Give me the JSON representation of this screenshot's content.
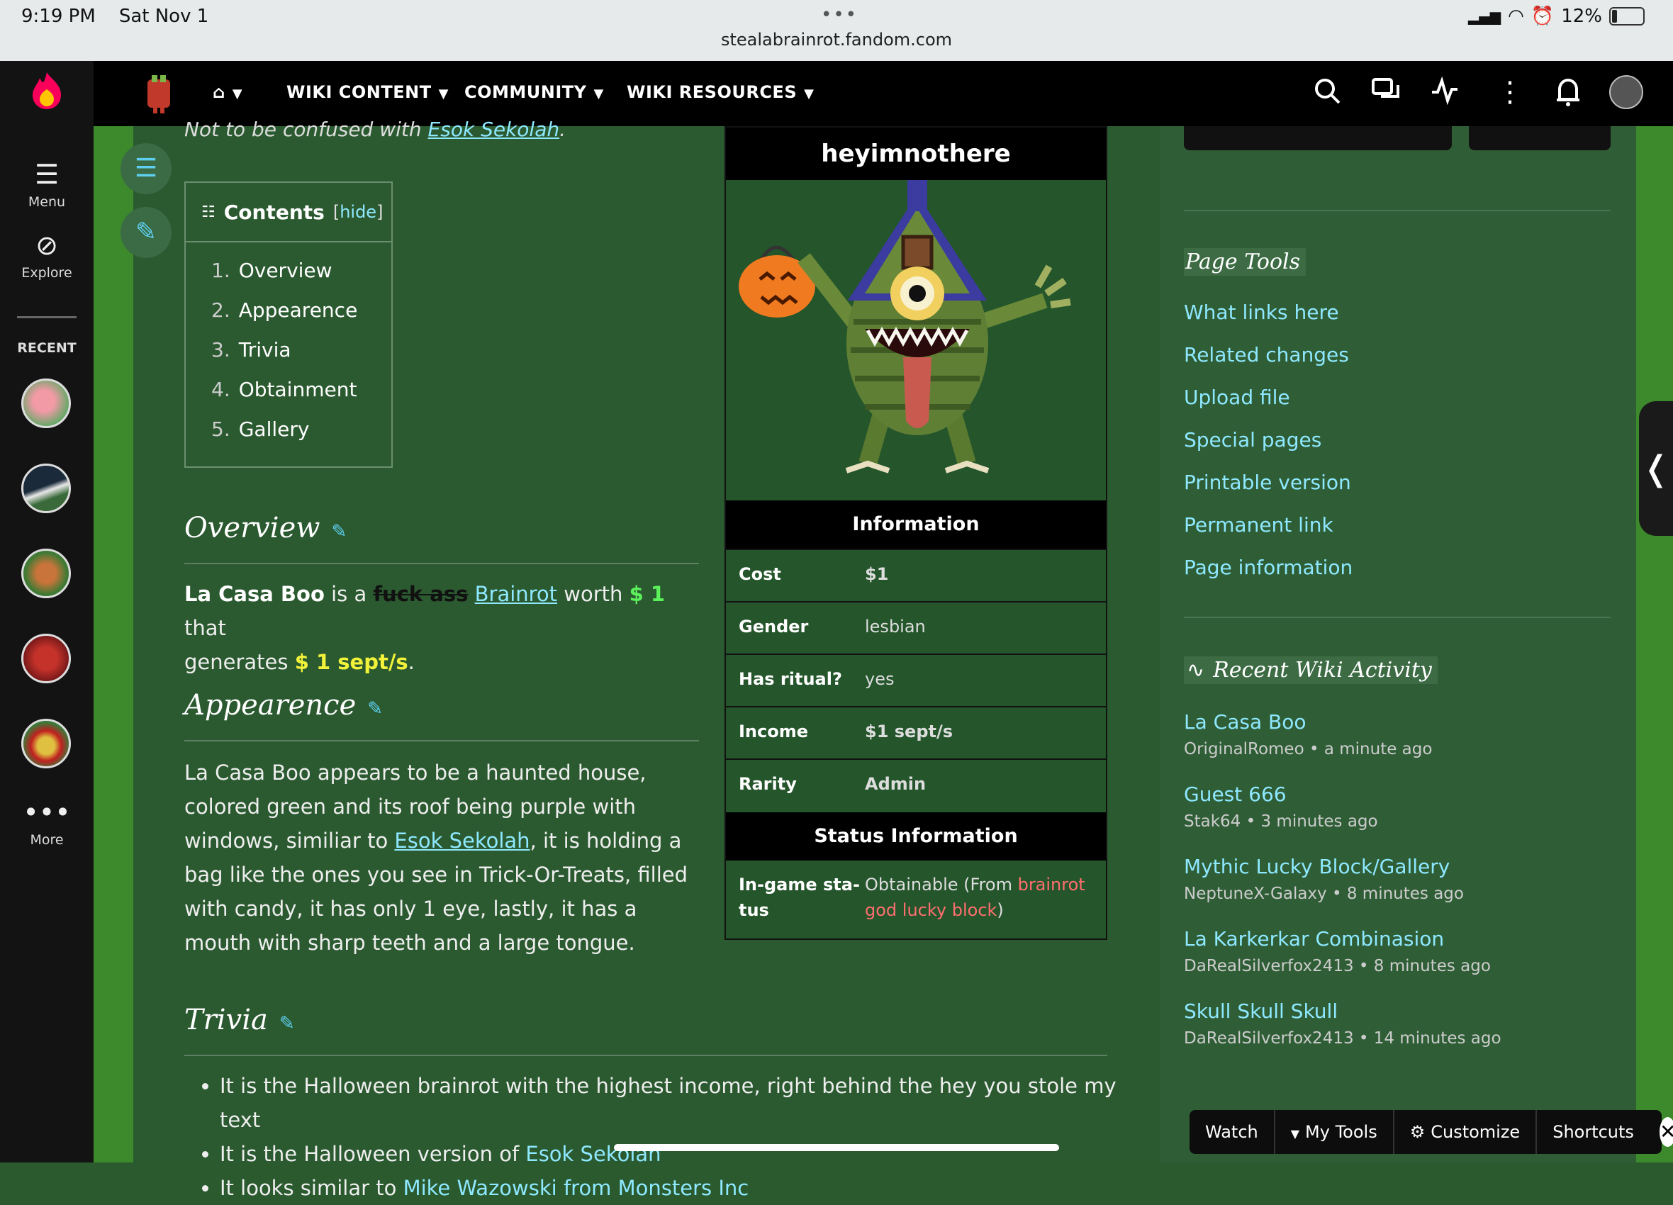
{
  "status_bar": {
    "time": "9:19 PM",
    "date": "Sat Nov 1",
    "url": "stealabrainrot.fandom.com",
    "battery": "12%"
  },
  "rail": {
    "menu_label": "Menu",
    "explore_label": "Explore",
    "recent_label": "RECENT",
    "more_label": "More"
  },
  "nav": {
    "items": [
      "WIKI CONTENT",
      "COMMUNITY",
      "WIKI RESOURCES"
    ]
  },
  "article": {
    "not_confused_prefix": "Not to be confused with ",
    "not_confused_link": "Esok Sekolah",
    "toc": {
      "title": "Contents",
      "hide": "hide",
      "items": [
        {
          "num": "1.",
          "label": "Overview"
        },
        {
          "num": "2.",
          "label": "Appearence"
        },
        {
          "num": "3.",
          "label": "Trivia"
        },
        {
          "num": "4.",
          "label": "Obtainment"
        },
        {
          "num": "5.",
          "label": "Gallery"
        }
      ]
    },
    "overview": {
      "heading": "Overview",
      "name": "La Casa Boo",
      "is_a": " is a ",
      "struck": "fuck ass",
      "brainrot_link": "Brainrot",
      "worth": " worth ",
      "cost": "$ 1",
      "that": " that",
      "generates": "generates ",
      "income": "$ 1 sept/s",
      "period": "."
    },
    "appearence": {
      "heading": "Appearence",
      "text1": "La Casa Boo appears to be a haunted house, colored green and its roof being purple with windows, similiar to ",
      "link": "Esok Sekolah",
      "text2": ", it is holding a bag like the ones you see in Trick-Or-Treats, filled with candy, it has only 1 eye, lastly, it has a mouth with sharp teeth and a large tongue."
    },
    "trivia": {
      "heading": "Trivia",
      "b1": "It is the Halloween brainrot with the highest income, right behind the hey you stole my text",
      "b2_prefix": "It is the Halloween version of ",
      "b2_link": "Esok Sekolah",
      "b3_prefix": "It looks similar to ",
      "b3_link": "Mike Wazowski from Monsters Inc"
    }
  },
  "infobox": {
    "title": "heyimnothere",
    "info_header": "Information",
    "rows": [
      {
        "k": "Cost",
        "v": "$1"
      },
      {
        "k": "Gender",
        "v": "lesbian"
      },
      {
        "k": "Has ritual?",
        "v": "yes"
      },
      {
        "k": "Income",
        "v": "$1 sept/s"
      },
      {
        "k": "Rarity",
        "v": "Admin"
      }
    ],
    "status_header": "Status Information",
    "ingame_key_1": "In-game sta-",
    "ingame_key_2": "tus",
    "ingame_val_prefix": "Obtainable (From ",
    "ingame_val_link_1": "brainrot",
    "ingame_val_link_2": "god lucky block",
    "ingame_val_suffix": ")"
  },
  "right_rail": {
    "page_tools_title": "Page Tools",
    "page_tools": [
      "What links here",
      "Related changes",
      "Upload file",
      "Special pages",
      "Printable version",
      "Permanent link",
      "Page information"
    ],
    "activity_title": "Recent Wiki Activity",
    "activity": [
      {
        "title": "La Casa Boo",
        "meta": "OriginalRomeo • a minute ago"
      },
      {
        "title": "Guest 666",
        "meta": "Stak64 • 3 minutes ago"
      },
      {
        "title": "Mythic Lucky Block/Gallery",
        "meta": "NeptuneX-Galaxy • 8 minutes ago"
      },
      {
        "title": "La Karkerkar Combinasion",
        "meta": "DaRealSilverfox2413 • 8 minutes ago"
      },
      {
        "title": "Skull Skull Skull",
        "meta": "DaRealSilverfox2413 • 14 minutes ago"
      }
    ]
  },
  "toolbar": {
    "watch": "Watch",
    "my_tools": "My Tools",
    "customize": "Customize",
    "shortcuts": "Shortcuts"
  },
  "colors": {
    "accent_link": "#8ee8ff",
    "page_bg": "#2b5a30",
    "fandom_orange": "#fa005a"
  }
}
